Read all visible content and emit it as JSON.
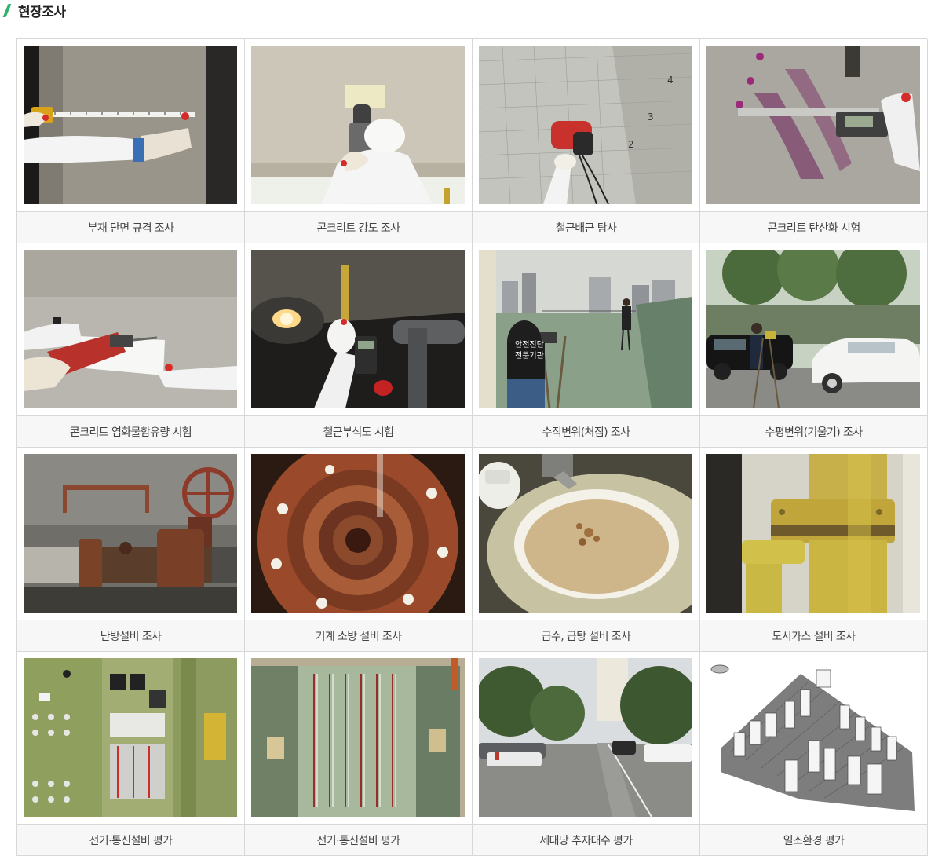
{
  "header": {
    "title": "현장조사"
  },
  "gallery": {
    "items": [
      {
        "caption": "부재 단면 규격 조사",
        "scene": "tape-measure"
      },
      {
        "caption": "콘크리트 강도 조사",
        "scene": "rebound-hammer"
      },
      {
        "caption": "철근배근 탐사",
        "scene": "rebar-scanner"
      },
      {
        "caption": "콘크리트 탄산화 시험",
        "scene": "caliper"
      },
      {
        "caption": "콘크리트 염화물함유량 시험",
        "scene": "drill"
      },
      {
        "caption": "철근부식도 시험",
        "scene": "corrosion-meter"
      },
      {
        "caption": "수직변위(처짐) 조사",
        "scene": "rooftop-survey",
        "vest_text_1": "안전진단",
        "vest_text_2": "전문기관"
      },
      {
        "caption": "수평변위(기울기) 조사",
        "scene": "street-survey"
      },
      {
        "caption": "난방설비 조사",
        "scene": "rusty-valve"
      },
      {
        "caption": "기계 소방 설비 조사",
        "scene": "rusty-pipe"
      },
      {
        "caption": "급수, 급탕 설비 조사",
        "scene": "water-basin"
      },
      {
        "caption": "도시가스 설비 조사",
        "scene": "gas-pipe"
      },
      {
        "caption": "전기·통신설비 평가",
        "scene": "control-panel"
      },
      {
        "caption": "전기·통신설비 평가",
        "scene": "terminal-cabinet"
      },
      {
        "caption": "세대당 추자대수 평가",
        "scene": "parking-lot"
      },
      {
        "caption": "일조환경 평가",
        "scene": "3d-model"
      }
    ]
  }
}
